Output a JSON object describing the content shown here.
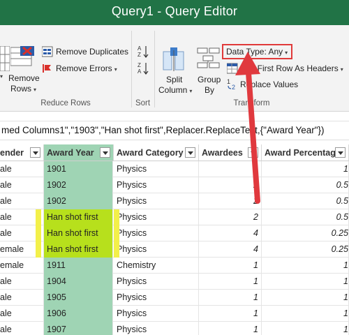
{
  "window": {
    "title": "Query1 - Query Editor"
  },
  "ribbon": {
    "remove_duplicates": "Remove Duplicates",
    "remove_errors": "Remove Errors",
    "remove_rows_line1": "Remove",
    "remove_rows_line2": "Rows",
    "reduce_rows_group": "Reduce Rows",
    "sort_group": "Sort",
    "split_column_line1": "Split",
    "split_column_line2": "Column",
    "group_by_line1": "Group",
    "group_by_line2": "By",
    "data_type": "Data Type: Any",
    "use_first_row": "Use First Row As Headers",
    "replace_values": "Replace Values",
    "transform_group": "Transform"
  },
  "formula": {
    "text": "med Columns1\",\"1903\",\"Han shot first\",Replacer.ReplaceText,{\"Award Year\"})"
  },
  "columns": [
    "ender",
    "Award Year",
    "Award Category",
    "Awardees",
    "Award Percentage"
  ],
  "rows": [
    {
      "gender": "ale",
      "year": "1901",
      "category": "Physics",
      "awardees": "1",
      "pct": "1"
    },
    {
      "gender": "ale",
      "year": "1902",
      "category": "Physics",
      "awardees": "2",
      "pct": "0.5"
    },
    {
      "gender": "ale",
      "year": "1902",
      "category": "Physics",
      "awardees": "2",
      "pct": "0.5"
    },
    {
      "gender": "ale",
      "year": "Han shot first",
      "category": "Physics",
      "awardees": "2",
      "pct": "0.5"
    },
    {
      "gender": "ale",
      "year": "Han shot first",
      "category": "Physics",
      "awardees": "4",
      "pct": "0.25"
    },
    {
      "gender": "emale",
      "year": "Han shot first",
      "category": "Physics",
      "awardees": "4",
      "pct": "0.25"
    },
    {
      "gender": "emale",
      "year": "1911",
      "category": "Chemistry",
      "awardees": "1",
      "pct": "1"
    },
    {
      "gender": "ale",
      "year": "1904",
      "category": "Physics",
      "awardees": "1",
      "pct": "1"
    },
    {
      "gender": "ale",
      "year": "1905",
      "category": "Physics",
      "awardees": "1",
      "pct": "1"
    },
    {
      "gender": "ale",
      "year": "1906",
      "category": "Physics",
      "awardees": "1",
      "pct": "1"
    },
    {
      "gender": "ale",
      "year": "1907",
      "category": "Physics",
      "awardees": "1",
      "pct": "1"
    }
  ],
  "colors": {
    "title_bar": "#217346",
    "highlight_column": "#9fd4b4",
    "replaced_cell": "#b7e01c",
    "callout": "#e03a3a"
  }
}
